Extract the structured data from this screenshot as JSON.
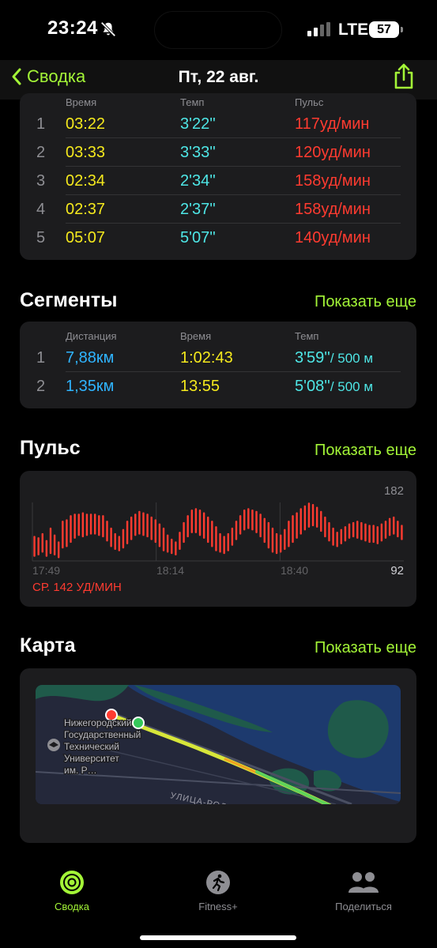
{
  "status": {
    "time": "23:24",
    "network": "LTE",
    "battery": "57"
  },
  "nav": {
    "back_label": "Сводка",
    "title": "Пт, 22 авг."
  },
  "splits": {
    "headers": [
      "Время",
      "Темп",
      "Пульс"
    ],
    "rows": [
      {
        "n": "1",
        "time": "03:22",
        "pace": "3'22''",
        "hr": "117уд/мин"
      },
      {
        "n": "2",
        "time": "03:33",
        "pace": "3'33''",
        "hr": "120уд/мин"
      },
      {
        "n": "3",
        "time": "02:34",
        "pace": "2'34''",
        "hr": "158уд/мин"
      },
      {
        "n": "4",
        "time": "02:37",
        "pace": "2'37''",
        "hr": "158уд/мин"
      },
      {
        "n": "5",
        "time": "05:07",
        "pace": "5'07''",
        "hr": "140уд/мин"
      }
    ]
  },
  "segments": {
    "title": "Сегменты",
    "more": "Показать еще",
    "headers": [
      "Дистанция",
      "Время",
      "Темп"
    ],
    "rows": [
      {
        "n": "1",
        "distance": "7,88км",
        "time": "1:02:43",
        "pace": "3'59''",
        "pace_unit": "/ 500 м"
      },
      {
        "n": "2",
        "distance": "1,35км",
        "time": "13:55",
        "pace": "5'08''",
        "pace_unit": "/ 500 м"
      }
    ]
  },
  "pulse": {
    "title": "Пульс",
    "more": "Показать еще",
    "max_label": "182",
    "min_label": "92",
    "x_labels": [
      "17:49",
      "18:14",
      "18:40"
    ],
    "avg_label": "СР. 142 УД/МИН"
  },
  "chart_data": {
    "type": "bar",
    "ylim": [
      92,
      182
    ],
    "x_ticks": [
      "17:49",
      "18:14",
      "18:40"
    ],
    "series": [
      {
        "color": "#ff3b30",
        "ranges": [
          [
            98,
            128
          ],
          [
            100,
            126
          ],
          [
            104,
            132
          ],
          [
            98,
            122
          ],
          [
            102,
            140
          ],
          [
            100,
            130
          ],
          [
            96,
            120
          ],
          [
            110,
            150
          ],
          [
            112,
            152
          ],
          [
            118,
            158
          ],
          [
            124,
            160
          ],
          [
            128,
            160
          ],
          [
            126,
            162
          ],
          [
            128,
            160
          ],
          [
            130,
            160
          ],
          [
            130,
            160
          ],
          [
            128,
            158
          ],
          [
            126,
            158
          ],
          [
            120,
            150
          ],
          [
            112,
            140
          ],
          [
            108,
            132
          ],
          [
            106,
            128
          ],
          [
            110,
            138
          ],
          [
            116,
            150
          ],
          [
            122,
            156
          ],
          [
            128,
            160
          ],
          [
            130,
            164
          ],
          [
            128,
            162
          ],
          [
            126,
            160
          ],
          [
            122,
            156
          ],
          [
            118,
            152
          ],
          [
            112,
            146
          ],
          [
            106,
            140
          ],
          [
            104,
            130
          ],
          [
            102,
            124
          ],
          [
            100,
            120
          ],
          [
            108,
            134
          ],
          [
            118,
            148
          ],
          [
            126,
            158
          ],
          [
            132,
            166
          ],
          [
            132,
            168
          ],
          [
            128,
            166
          ],
          [
            124,
            162
          ],
          [
            118,
            156
          ],
          [
            112,
            150
          ],
          [
            106,
            142
          ],
          [
            104,
            132
          ],
          [
            102,
            128
          ],
          [
            106,
            132
          ],
          [
            114,
            140
          ],
          [
            122,
            150
          ],
          [
            130,
            158
          ],
          [
            136,
            166
          ],
          [
            138,
            168
          ],
          [
            136,
            166
          ],
          [
            132,
            164
          ],
          [
            126,
            160
          ],
          [
            118,
            154
          ],
          [
            110,
            148
          ],
          [
            104,
            140
          ],
          [
            102,
            132
          ],
          [
            104,
            130
          ],
          [
            108,
            138
          ],
          [
            112,
            150
          ],
          [
            118,
            158
          ],
          [
            124,
            162
          ],
          [
            130,
            168
          ],
          [
            136,
            172
          ],
          [
            140,
            176
          ],
          [
            142,
            174
          ],
          [
            140,
            170
          ],
          [
            134,
            164
          ],
          [
            126,
            156
          ],
          [
            120,
            148
          ],
          [
            114,
            140
          ],
          [
            112,
            134
          ],
          [
            116,
            138
          ],
          [
            120,
            142
          ],
          [
            124,
            146
          ],
          [
            126,
            148
          ],
          [
            124,
            150
          ],
          [
            122,
            148
          ],
          [
            120,
            146
          ],
          [
            118,
            144
          ],
          [
            118,
            144
          ],
          [
            116,
            142
          ],
          [
            120,
            146
          ],
          [
            124,
            150
          ],
          [
            128,
            154
          ],
          [
            130,
            156
          ],
          [
            126,
            150
          ],
          [
            122,
            144
          ]
        ]
      }
    ]
  },
  "map": {
    "title": "Карта",
    "more": "Показать еще",
    "place_label": "Нижегородский Государственный Технический Университет им. Р…",
    "place_lines": [
      "Нижегородский",
      "Государственный",
      "Технический",
      "Университет",
      "им. Р…"
    ],
    "street_label": "УЛИЦА-РОДИО"
  },
  "tabs": [
    {
      "label": "Сводка",
      "icon": "activity-rings-icon",
      "active": true
    },
    {
      "label": "Fitness+",
      "icon": "running-figure-icon",
      "active": false
    },
    {
      "label": "Поделиться",
      "icon": "people-icon",
      "active": false
    }
  ],
  "colors": {
    "accent": "#a3f537",
    "yellow": "#f5e91d",
    "cyan": "#4ee6e6",
    "red": "#ff3b30",
    "blue": "#2fb4ff"
  }
}
